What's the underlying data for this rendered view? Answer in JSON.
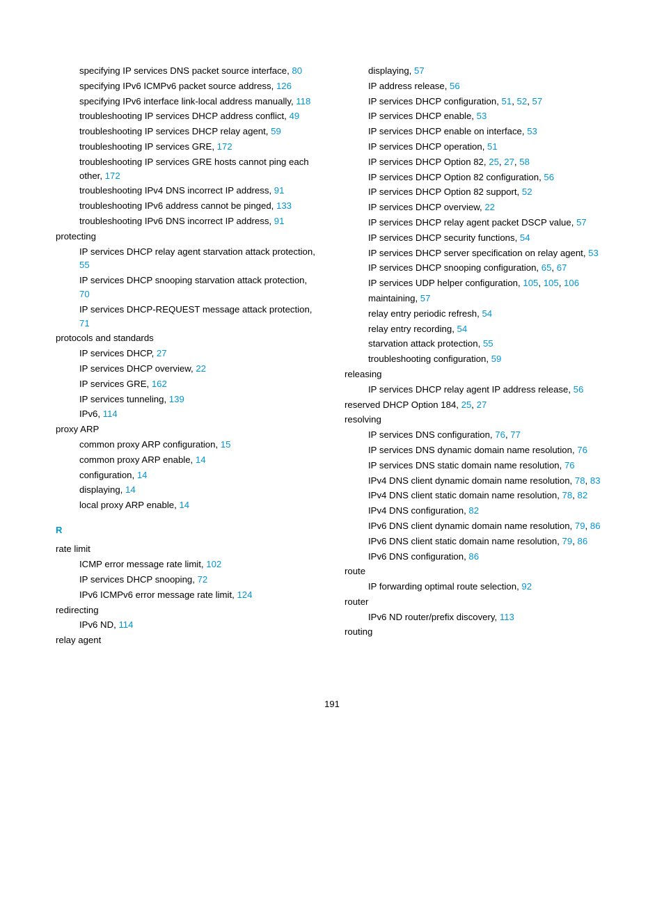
{
  "pageNumber": "191",
  "sectionLetter": "R",
  "left": [
    {
      "level": 2,
      "pre": "specifying IP services DNS packet source interface, ",
      "links": [
        "80"
      ]
    },
    {
      "level": 2,
      "pre": "specifying IPv6 ICMPv6 packet source address, ",
      "links": [
        "126"
      ]
    },
    {
      "level": 2,
      "pre": "specifying IPv6 interface link-local address manually, ",
      "links": [
        "118"
      ]
    },
    {
      "level": 2,
      "pre": "troubleshooting IP services DHCP address conflict, ",
      "links": [
        "49"
      ]
    },
    {
      "level": 2,
      "pre": "troubleshooting IP services DHCP relay agent, ",
      "links": [
        "59"
      ]
    },
    {
      "level": 2,
      "pre": "troubleshooting IP services GRE, ",
      "links": [
        "172"
      ]
    },
    {
      "level": 2,
      "pre": "troubleshooting IP services GRE hosts cannot ping each other, ",
      "links": [
        "172"
      ]
    },
    {
      "level": 2,
      "pre": "troubleshooting IPv4 DNS incorrect IP address, ",
      "links": [
        "91"
      ]
    },
    {
      "level": 2,
      "pre": "troubleshooting IPv6 address cannot be pinged, ",
      "links": [
        "133"
      ]
    },
    {
      "level": 2,
      "pre": "troubleshooting IPv6 DNS incorrect IP address, ",
      "links": [
        "91"
      ]
    },
    {
      "level": 1,
      "pre": "protecting",
      "links": []
    },
    {
      "level": 2,
      "pre": "IP services DHCP relay agent starvation attack protection, ",
      "links": [
        "55"
      ]
    },
    {
      "level": 2,
      "pre": "IP services DHCP snooping starvation attack protection, ",
      "links": [
        "70"
      ]
    },
    {
      "level": 2,
      "pre": "IP services DHCP-REQUEST message attack protection, ",
      "links": [
        "71"
      ]
    },
    {
      "level": 1,
      "pre": "protocols and standards",
      "links": []
    },
    {
      "level": 2,
      "pre": "IP services DHCP, ",
      "links": [
        "27"
      ]
    },
    {
      "level": 2,
      "pre": "IP services DHCP overview, ",
      "links": [
        "22"
      ]
    },
    {
      "level": 2,
      "pre": "IP services GRE, ",
      "links": [
        "162"
      ]
    },
    {
      "level": 2,
      "pre": "IP services tunneling, ",
      "links": [
        "139"
      ]
    },
    {
      "level": 2,
      "pre": "IPv6, ",
      "links": [
        "114"
      ]
    },
    {
      "level": 1,
      "pre": "proxy ARP",
      "links": []
    },
    {
      "level": 2,
      "pre": "common proxy ARP configuration, ",
      "links": [
        "15"
      ]
    },
    {
      "level": 2,
      "pre": "common proxy ARP enable, ",
      "links": [
        "14"
      ]
    },
    {
      "level": 2,
      "pre": "configuration, ",
      "links": [
        "14"
      ]
    },
    {
      "level": 2,
      "pre": "displaying, ",
      "links": [
        "14"
      ]
    },
    {
      "level": 2,
      "pre": "local proxy ARP enable, ",
      "links": [
        "14"
      ]
    },
    {
      "level": 0,
      "section": true
    },
    {
      "level": 1,
      "pre": "rate limit",
      "links": []
    },
    {
      "level": 2,
      "pre": "ICMP error message rate limit, ",
      "links": [
        "102"
      ]
    },
    {
      "level": 2,
      "pre": "IP services DHCP snooping, ",
      "links": [
        "72"
      ]
    },
    {
      "level": 2,
      "pre": "IPv6 ICMPv6 error message rate limit, ",
      "links": [
        "124"
      ]
    },
    {
      "level": 1,
      "pre": "redirecting",
      "links": []
    },
    {
      "level": 2,
      "pre": "IPv6 ND, ",
      "links": [
        "114"
      ]
    },
    {
      "level": 1,
      "pre": "relay agent",
      "links": []
    }
  ],
  "right": [
    {
      "level": 2,
      "pre": "displaying, ",
      "links": [
        "57"
      ]
    },
    {
      "level": 2,
      "pre": "IP address release, ",
      "links": [
        "56"
      ]
    },
    {
      "level": 2,
      "pre": "IP services DHCP configuration, ",
      "links": [
        "51",
        "52",
        "57"
      ]
    },
    {
      "level": 2,
      "pre": "IP services DHCP enable, ",
      "links": [
        "53"
      ]
    },
    {
      "level": 2,
      "pre": "IP services DHCP enable on interface, ",
      "links": [
        "53"
      ]
    },
    {
      "level": 2,
      "pre": "IP services DHCP operation, ",
      "links": [
        "51"
      ]
    },
    {
      "level": 2,
      "pre": "IP services DHCP Option 82, ",
      "links": [
        "25",
        "27",
        "58"
      ]
    },
    {
      "level": 2,
      "pre": "IP services DHCP Option 82 configuration, ",
      "links": [
        "56"
      ]
    },
    {
      "level": 2,
      "pre": "IP services DHCP Option 82 support, ",
      "links": [
        "52"
      ]
    },
    {
      "level": 2,
      "pre": "IP services DHCP overview, ",
      "links": [
        "22"
      ]
    },
    {
      "level": 2,
      "pre": "IP services DHCP relay agent packet DSCP value, ",
      "links": [
        "57"
      ]
    },
    {
      "level": 2,
      "pre": "IP services DHCP security functions, ",
      "links": [
        "54"
      ]
    },
    {
      "level": 2,
      "pre": "IP services DHCP server specification on relay agent, ",
      "links": [
        "53"
      ]
    },
    {
      "level": 2,
      "pre": "IP services DHCP snooping configuration, ",
      "links": [
        "65",
        "67"
      ]
    },
    {
      "level": 2,
      "pre": "IP services UDP helper configuration, ",
      "links": [
        "105",
        "105",
        "106"
      ]
    },
    {
      "level": 2,
      "pre": "maintaining, ",
      "links": [
        "57"
      ]
    },
    {
      "level": 2,
      "pre": "relay entry periodic refresh, ",
      "links": [
        "54"
      ]
    },
    {
      "level": 2,
      "pre": "relay entry recording, ",
      "links": [
        "54"
      ]
    },
    {
      "level": 2,
      "pre": "starvation attack protection, ",
      "links": [
        "55"
      ]
    },
    {
      "level": 2,
      "pre": "troubleshooting configuration, ",
      "links": [
        "59"
      ]
    },
    {
      "level": 1,
      "pre": "releasing",
      "links": []
    },
    {
      "level": 2,
      "pre": "IP services DHCP relay agent IP address release, ",
      "links": [
        "56"
      ]
    },
    {
      "level": 1,
      "pre": "reserved DHCP Option 184, ",
      "links": [
        "25",
        "27"
      ]
    },
    {
      "level": 1,
      "pre": "resolving",
      "links": []
    },
    {
      "level": 2,
      "pre": "IP services DNS configuration, ",
      "links": [
        "76",
        "77"
      ]
    },
    {
      "level": 2,
      "pre": "IP services DNS dynamic domain name resolution, ",
      "links": [
        "76"
      ]
    },
    {
      "level": 2,
      "pre": "IP services DNS static domain name resolution, ",
      "links": [
        "76"
      ]
    },
    {
      "level": 2,
      "pre": "IPv4 DNS client dynamic domain name resolution, ",
      "links": [
        "78",
        "83"
      ]
    },
    {
      "level": 2,
      "pre": "IPv4 DNS client static domain name resolution, ",
      "links": [
        "78",
        "82"
      ]
    },
    {
      "level": 2,
      "pre": "IPv4 DNS configuration, ",
      "links": [
        "82"
      ]
    },
    {
      "level": 2,
      "pre": "IPv6 DNS client dynamic domain name resolution, ",
      "links": [
        "79",
        "86"
      ]
    },
    {
      "level": 2,
      "pre": "IPv6 DNS client static domain name resolution, ",
      "links": [
        "79",
        "86"
      ]
    },
    {
      "level": 2,
      "pre": "IPv6 DNS configuration, ",
      "links": [
        "86"
      ]
    },
    {
      "level": 1,
      "pre": "route",
      "links": []
    },
    {
      "level": 2,
      "pre": "IP forwarding optimal route selection, ",
      "links": [
        "92"
      ]
    },
    {
      "level": 1,
      "pre": "router",
      "links": []
    },
    {
      "level": 2,
      "pre": "IPv6 ND router/prefix discovery, ",
      "links": [
        "113"
      ]
    },
    {
      "level": 1,
      "pre": "routing",
      "links": []
    }
  ]
}
